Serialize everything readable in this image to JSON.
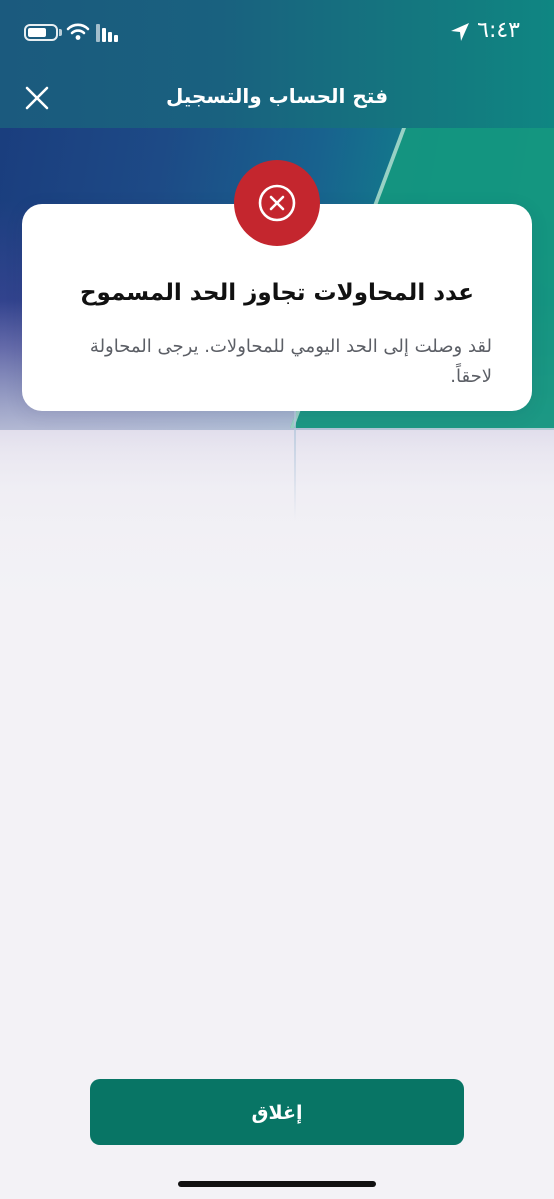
{
  "status_bar": {
    "time": "٦:٤٣",
    "battery_icon": "battery-icon",
    "wifi_icon": "wifi-icon",
    "signal_icon": "signal-icon",
    "location_icon": "location-arrow-icon"
  },
  "header": {
    "title": "فتح الحساب والتسجيل",
    "close_icon": "close-icon"
  },
  "error_card": {
    "icon": "error-circle-x-icon",
    "title": "عدد المحاولات تجاوز الحد المسموح",
    "message": "لقد وصلت إلى الحد اليومي للمحاولات. يرجى المحاولة لاحقاً."
  },
  "footer": {
    "close_label": "إغلاق"
  },
  "colors": {
    "primary_button": "#087565",
    "error_badge": "#c4262e",
    "header_teal": "#19617f",
    "background": "#f3f2f6"
  }
}
